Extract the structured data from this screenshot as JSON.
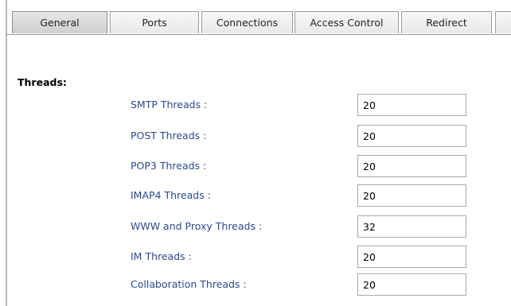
{
  "tabs": [
    {
      "label": "General",
      "active": true
    },
    {
      "label": "Ports",
      "active": false
    },
    {
      "label": "Connections",
      "active": false
    },
    {
      "label": "Access Control",
      "active": false
    },
    {
      "label": "Redirect",
      "active": false
    }
  ],
  "section": {
    "title": "Threads:"
  },
  "rows": [
    {
      "label": "SMTP Threads :",
      "value": "20"
    },
    {
      "label": "POST Threads :",
      "value": "20"
    },
    {
      "label": "POP3 Threads :",
      "value": "20"
    },
    {
      "label": "IMAP4 Threads :",
      "value": "20"
    },
    {
      "label": "WWW and Proxy Threads :",
      "value": "32"
    },
    {
      "label": "IM Threads :",
      "value": "20"
    },
    {
      "label": "Collaboration Threads :",
      "value": "20"
    }
  ],
  "colors": {
    "label_text": "#2a4b8f",
    "active_tab_bg": "#cfcfcf",
    "inactive_tab_bg": "#efefef"
  }
}
